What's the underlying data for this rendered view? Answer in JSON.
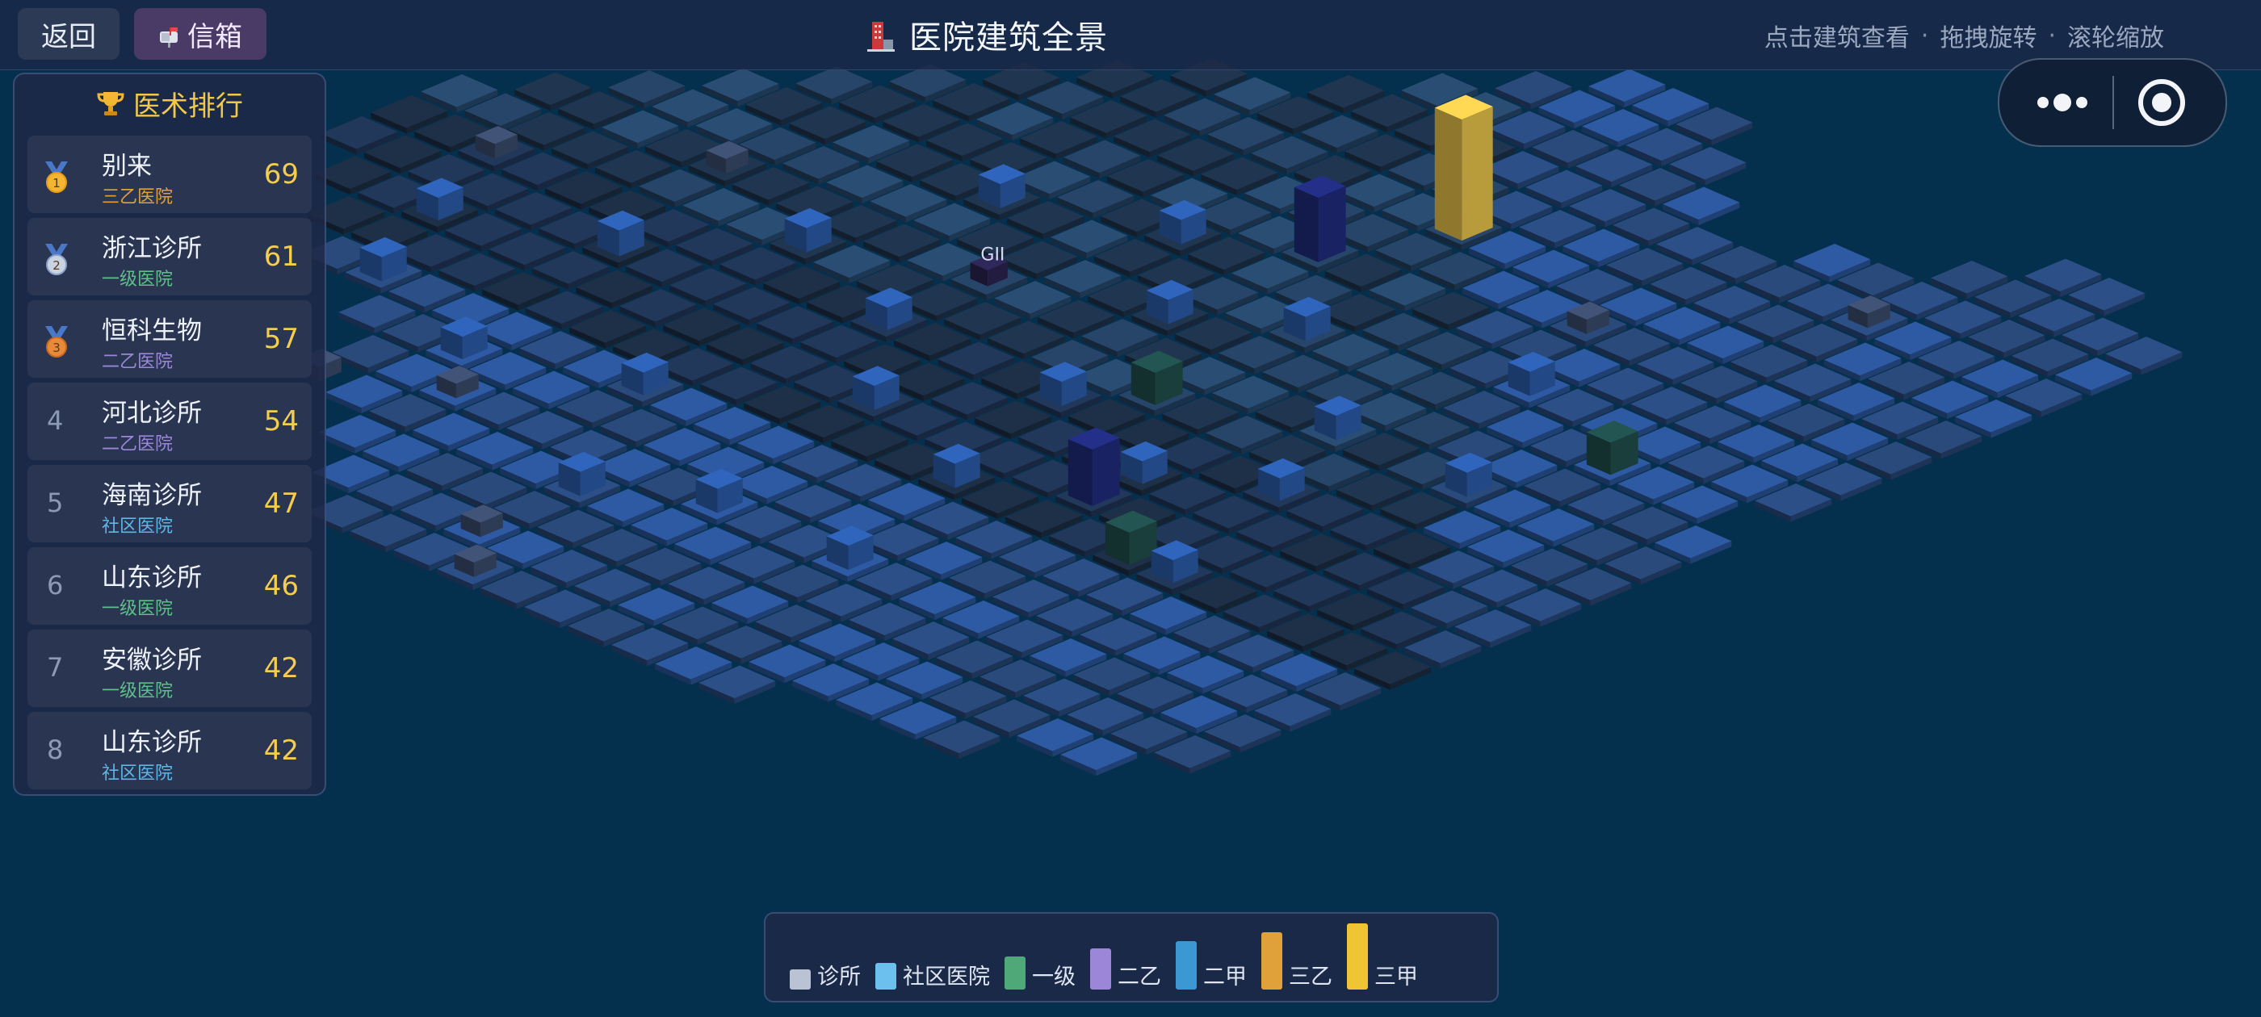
{
  "topbar": {
    "back_label": "返回",
    "mail_label": "信箱",
    "title": "医院建筑全景",
    "hints": [
      "点击建筑查看",
      "拖拽旋转",
      "滚轮缩放"
    ],
    "hint_separator": "·"
  },
  "ranking": {
    "title": "医术排行",
    "items": [
      {
        "rank": "1",
        "name": "别来",
        "level": "三乙医院",
        "level_color": "#e0a03a",
        "score": "69",
        "medal": "gold"
      },
      {
        "rank": "2",
        "name": "浙江诊所",
        "level": "一级医院",
        "level_color": "#5fbf8a",
        "score": "61",
        "medal": "silver"
      },
      {
        "rank": "3",
        "name": "恒科生物",
        "level": "二乙医院",
        "level_color": "#9b86d8",
        "score": "57",
        "medal": "bronze"
      },
      {
        "rank": "4",
        "name": "河北诊所",
        "level": "二乙医院",
        "level_color": "#9b86d8",
        "score": "54"
      },
      {
        "rank": "5",
        "name": "海南诊所",
        "level": "社区医院",
        "level_color": "#5fb6e6",
        "score": "47"
      },
      {
        "rank": "6",
        "name": "山东诊所",
        "level": "一级医院",
        "level_color": "#5fbf8a",
        "score": "46"
      },
      {
        "rank": "7",
        "name": "安徽诊所",
        "level": "一级医院",
        "level_color": "#5fbf8a",
        "score": "42"
      },
      {
        "rank": "8",
        "name": "山东诊所",
        "level": "社区医院",
        "level_color": "#5fb6e6",
        "score": "42"
      }
    ]
  },
  "legend": {
    "items": [
      {
        "label": "诊所",
        "color": "#b9c3d3",
        "level": 0.18
      },
      {
        "label": "社区医院",
        "color": "#6cc0ee",
        "level": 0.3
      },
      {
        "label": "一级",
        "color": "#4fa878",
        "level": 0.42
      },
      {
        "label": "二乙",
        "color": "#9b86d8",
        "level": 0.55
      },
      {
        "label": "二甲",
        "color": "#3b98d2",
        "level": 0.68
      },
      {
        "label": "三乙",
        "color": "#e0a03a",
        "level": 0.84
      },
      {
        "label": "三甲",
        "color": "#f0c534",
        "level": 1.0
      }
    ]
  },
  "colors": {
    "background": "#05304d",
    "tile_dark": "#1c2e45",
    "tile_mid": "#2a4a72",
    "tile_blue": "#2e5aa3",
    "building_blue": "#2a5aa8",
    "tower_gold": "#e6c24a"
  },
  "scene": {
    "sign_text": "GII"
  }
}
